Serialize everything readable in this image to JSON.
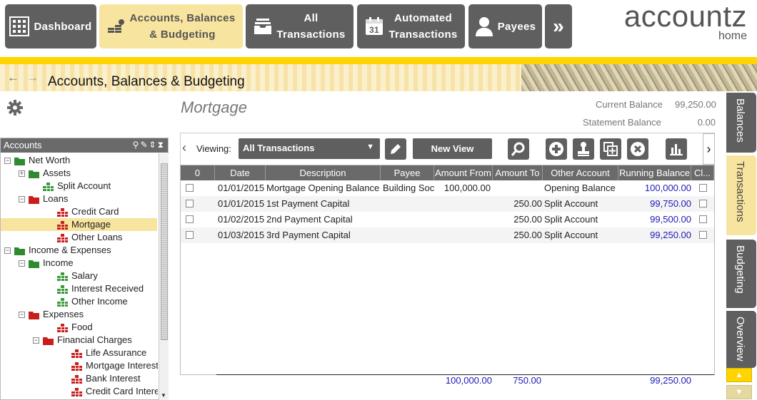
{
  "nav": {
    "dashboard": "Dashboard",
    "accounts_l1": "Accounts, Balances",
    "accounts_l2": "& Budgeting",
    "all_l1": "All",
    "all_l2": "Transactions",
    "auto_l1": "Automated",
    "auto_l2": "Transactions",
    "calendar_day": "31",
    "payees": "Payees",
    "more": "»"
  },
  "logo": {
    "name": "accountz",
    "sub": "home"
  },
  "breadcrumb": {
    "back": "←",
    "forward": "→",
    "title": "Accounts, Balances & Budgeting"
  },
  "accounts_panel": {
    "header": "Accounts",
    "tree": [
      {
        "label": "Net Worth",
        "toggle": "−",
        "icon": "folder-green"
      },
      {
        "label": "Assets",
        "toggle": "+",
        "icon": "folder-green"
      },
      {
        "label": "Split Account",
        "icon": "account-green"
      },
      {
        "label": "Loans",
        "toggle": "−",
        "icon": "folder-red"
      },
      {
        "label": "Credit Card",
        "icon": "account-red"
      },
      {
        "label": "Mortgage",
        "icon": "account-red",
        "selected": true
      },
      {
        "label": "Other Loans",
        "icon": "account-red"
      },
      {
        "label": "Income & Expenses",
        "toggle": "−",
        "icon": "folder-green"
      },
      {
        "label": "Income",
        "toggle": "−",
        "icon": "folder-green"
      },
      {
        "label": "Salary",
        "icon": "account-green"
      },
      {
        "label": "Interest Received",
        "icon": "account-green"
      },
      {
        "label": "Other Income",
        "icon": "account-green"
      },
      {
        "label": "Expenses",
        "toggle": "−",
        "icon": "folder-red"
      },
      {
        "label": "Food",
        "icon": "account-red"
      },
      {
        "label": "Financial Charges",
        "toggle": "−",
        "icon": "folder-red"
      },
      {
        "label": "Life Assurance",
        "icon": "account-red"
      },
      {
        "label": "Mortgage Interest",
        "icon": "account-red"
      },
      {
        "label": "Bank Interest",
        "icon": "account-red"
      },
      {
        "label": "Credit Card Interest",
        "icon": "account-red"
      }
    ]
  },
  "account": {
    "title": "Mortgage",
    "current_balance_label": "Current Balance",
    "current_balance": "99,250.00",
    "statement_balance_label": "Statement Balance",
    "statement_balance": "0.00"
  },
  "toolbar": {
    "viewing_label": "Viewing:",
    "view_value": "All Transactions",
    "new_view_label": "New View",
    "prev": "‹",
    "next": "›"
  },
  "grid": {
    "columns": [
      "0",
      "Date",
      "Description",
      "Payee",
      "Amount From",
      "Amount To",
      "Other Account",
      "Running Balance",
      "Cl..."
    ],
    "rows": [
      {
        "date": "01/01/2015",
        "description": "Mortgage Opening Balance",
        "payee": "Building Soc",
        "amount_from": "100,000.00",
        "amount_to": "",
        "other_account": "Opening Balance",
        "running_balance": "100,000.00"
      },
      {
        "date": "01/01/2015",
        "description": "1st Payment Capital",
        "payee": "",
        "amount_from": "",
        "amount_to": "250.00",
        "other_account": "Split Account",
        "running_balance": "99,750.00"
      },
      {
        "date": "01/02/2015",
        "description": "2nd Payment Capital",
        "payee": "",
        "amount_from": "",
        "amount_to": "250.00",
        "other_account": "Split Account",
        "running_balance": "99,500.00"
      },
      {
        "date": "01/03/2015",
        "description": "3rd Payment Capital",
        "payee": "",
        "amount_from": "",
        "amount_to": "250.00",
        "other_account": "Split Account",
        "running_balance": "99,250.00"
      }
    ],
    "totals": {
      "amount_from": "100,000.00",
      "amount_to": "750.00",
      "running_balance": "99,250.00"
    }
  },
  "side_tabs": [
    "Balances",
    "Transactions",
    "Budgeting",
    "Overview"
  ],
  "side_tabs_active": "Transactions",
  "colors": {
    "accent_yellow": "#ffd400",
    "button_dark": "#5f5f5f",
    "active_tab": "#f7e49e",
    "balance_blue": "#1a1ab8"
  }
}
